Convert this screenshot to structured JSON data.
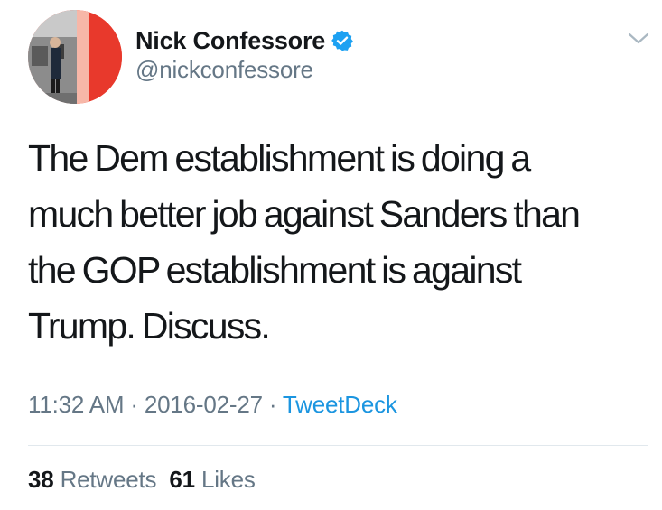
{
  "user": {
    "display_name": "Nick Confessore",
    "handle": "@nickconfessore",
    "verified_icon": "verified-badge-icon",
    "avatar_icon": "profile-photo"
  },
  "menu": {
    "icon": "chevron-down-icon"
  },
  "tweet": {
    "text": "The Dem establishment is doing a\nmuch better job against Sanders than\nthe GOP establishment is against\nTrump. Discuss.",
    "time": "11:32 AM",
    "separator": "·",
    "date": "2016-02-27",
    "source": "TweetDeck"
  },
  "stats": {
    "retweets_count": "38",
    "retweets_label": "Retweets",
    "likes_count": "61",
    "likes_label": "Likes"
  },
  "colors": {
    "text_primary": "#14171a",
    "text_secondary": "#657786",
    "link": "#1b95e0",
    "verified": "#1da1f2",
    "divider": "#e1e8ed"
  }
}
